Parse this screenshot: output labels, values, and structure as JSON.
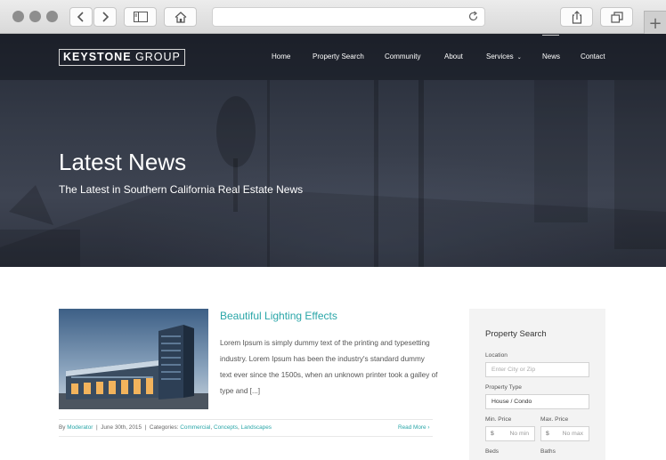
{
  "browser": {
    "back_icon": "chevron-left-icon",
    "forward_icon": "chevron-right-icon",
    "sidebar_icon": "sidebar-icon",
    "home_icon": "home-icon",
    "reload_icon": "reload-icon",
    "share_icon": "share-icon",
    "tabs_icon": "tabs-icon",
    "new_tab_icon": "plus-icon"
  },
  "site": {
    "logo_bold": "KEYSTONE",
    "logo_rest": "GROUP",
    "nav": [
      {
        "label": "Home"
      },
      {
        "label": "Property Search"
      },
      {
        "label": "Community"
      },
      {
        "label": "About"
      },
      {
        "label": "Services",
        "has_dropdown": true
      },
      {
        "label": "News",
        "active": true
      },
      {
        "label": "Contact"
      }
    ]
  },
  "hero": {
    "title": "Latest News",
    "subtitle": "The Latest in Southern California Real Estate News"
  },
  "post": {
    "title": "Beautiful Lighting Effects",
    "excerpt": "Lorem Ipsum is simply dummy text of the printing and typesetting industry. Lorem Ipsum has been the industry's standard dummy text ever since the 1500s, when an unknown printer took a galley of type and [...]",
    "meta": {
      "by": "By",
      "author": "Moderator",
      "sep": "|",
      "date": "June 30th, 2015",
      "categories_label": "Categories:",
      "categories": [
        "Commercial",
        "Concepts",
        "Landscapes"
      ]
    },
    "read_more": "Read More"
  },
  "widget": {
    "title": "Property Search",
    "location_label": "Location",
    "location_placeholder": "Enter City or Zip",
    "type_label": "Property Type",
    "type_value": "House / Condo",
    "min_price_label": "Min. Price",
    "max_price_label": "Max. Price",
    "currency": "$",
    "min_placeholder": "No min",
    "max_placeholder": "No max",
    "beds_label": "Beds",
    "baths_label": "Baths"
  },
  "colors": {
    "accent": "#2aa6a8",
    "hero_dark": "#2c313d"
  }
}
